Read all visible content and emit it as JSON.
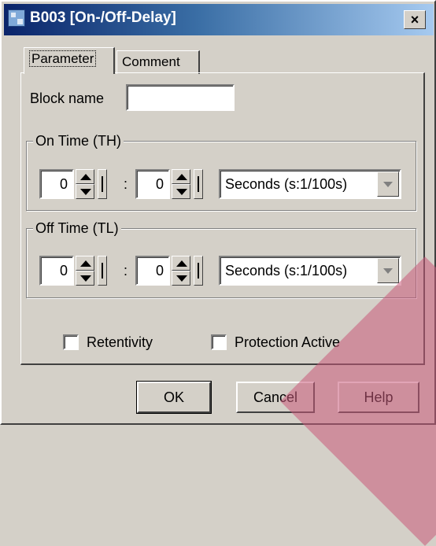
{
  "window": {
    "title": "B003 [On-/Off-Delay]",
    "close_label": "×"
  },
  "tabs": [
    {
      "label": "Parameter"
    },
    {
      "label": "Comment"
    }
  ],
  "block_name": {
    "label": "Block name",
    "value": ""
  },
  "on_time": {
    "legend": "On Time (TH)",
    "value1": "0",
    "value2": "0",
    "separator": ":",
    "unit": "Seconds (s:1/100s)"
  },
  "off_time": {
    "legend": "Off Time (TL)",
    "value1": "0",
    "value2": "0",
    "separator": ":",
    "unit": "Seconds (s:1/100s)"
  },
  "options": {
    "retentivity_label": "Retentivity",
    "protection_label": "Protection Active"
  },
  "buttons": {
    "ok": "OK",
    "cancel": "Cancel",
    "help": "Help"
  },
  "colors": {
    "face": "#d4d0c8",
    "title_start": "#0a246a",
    "title_end": "#a6caf0"
  }
}
